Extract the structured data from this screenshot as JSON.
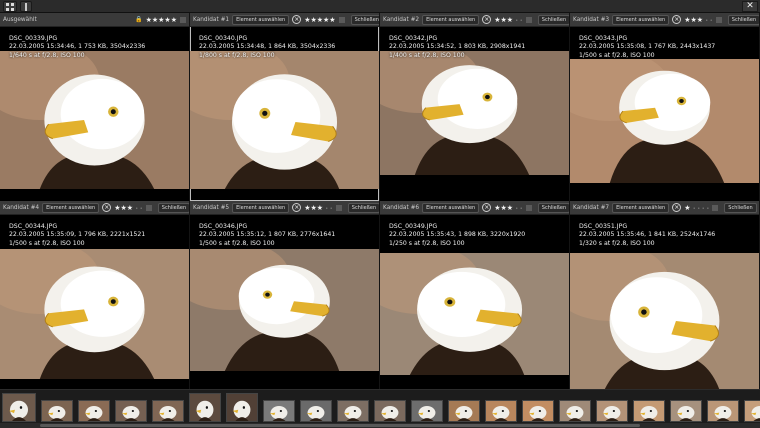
{
  "toolbar": {
    "grid_view_icon": "grid-icon",
    "single_view_icon": "single-view-icon",
    "close_glyph": "✕"
  },
  "accent": "#bdbdbd",
  "cells": [
    {
      "label": "Ausgewählt",
      "select": "",
      "close": "",
      "stars": "★★★★★",
      "dim": "",
      "file": "DSC_00339.JPG",
      "meta": "22.03.2005 15:34:46, 1 753 KB, 3504x2336",
      "exposure": "1/640 s at f/2.8, ISO 100"
    },
    {
      "label": "Kandidat #1",
      "select": "Element auswählen",
      "close": "Schließen",
      "stars": "★★★★★",
      "dim": "",
      "file": "DSC_00340.JPG",
      "meta": "22.03.2005 15:34:48, 1 864 KB, 3504x2336",
      "exposure": "1/800 s at f/2.8, ISO 100"
    },
    {
      "label": "Kandidat #2",
      "select": "Element auswählen",
      "close": "Schließen",
      "stars": "★★★",
      "dim": "• •",
      "file": "DSC_00342.JPG",
      "meta": "22.03.2005 15:34:52, 1 803 KB, 2908x1941",
      "exposure": "1/400 s at f/2.8, ISO 100"
    },
    {
      "label": "Kandidat #3",
      "select": "Element auswählen",
      "close": "Schließen",
      "stars": "★★★",
      "dim": "• •",
      "file": "DSC_00343.JPG",
      "meta": "22.03.2005 15:35:08, 1 767 KB, 2443x1437",
      "exposure": "1/500 s at f/2.8, ISO 100"
    },
    {
      "label": "Kandidat #4",
      "select": "Element auswählen",
      "close": "Schließen",
      "stars": "★★★",
      "dim": "• •",
      "file": "DSC_00344.JPG",
      "meta": "22.03.2005 15:35:09, 1 796 KB, 2221x1521",
      "exposure": "1/500 s at f/2.8, ISO 100"
    },
    {
      "label": "Kandidat #5",
      "select": "Element auswählen",
      "close": "Schließen",
      "stars": "★★★",
      "dim": "• •",
      "file": "DSC_00346.JPG",
      "meta": "22.03.2005 15:35:12, 1 807 KB, 2776x1641",
      "exposure": "1/500 s at f/2.8, ISO 100"
    },
    {
      "label": "Kandidat #6",
      "select": "Element auswählen",
      "close": "Schließen",
      "stars": "★★★",
      "dim": "• •",
      "file": "DSC_00349.JPG",
      "meta": "22.03.2005 15:35:43, 1 898 KB, 3220x1920",
      "exposure": "1/250 s at f/2.8, ISO 100"
    },
    {
      "label": "Kandidat #7",
      "select": "Element auswählen",
      "close": "Schließen",
      "stars": "★",
      "dim": "• • • •",
      "file": "DSC_00351.JPG",
      "meta": "22.03.2005 15:35:46, 1 841 KB, 2524x1746",
      "exposure": "1/320 s at f/2.8, ISO 100"
    }
  ],
  "filmstrip": {
    "count": 21
  }
}
